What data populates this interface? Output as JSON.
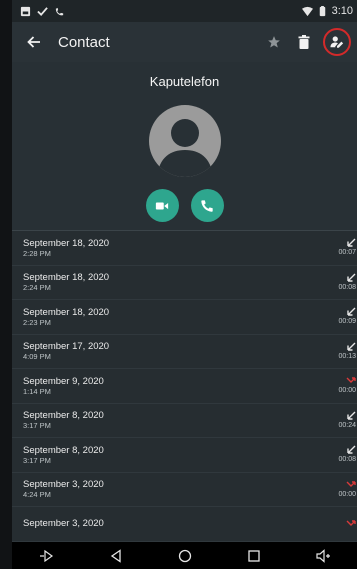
{
  "status_bar": {
    "time": "3:10"
  },
  "app_bar": {
    "title": "Contact"
  },
  "contact": {
    "name": "Kaputelefon"
  },
  "colors": {
    "accent": "#2ea68e",
    "missed": "#d83a3a",
    "highlight_ring": "#d32a2a"
  },
  "history": [
    {
      "date": "September 18, 2020",
      "time": "2:28 PM",
      "duration": "00:07",
      "type": "incoming"
    },
    {
      "date": "September 18, 2020",
      "time": "2:24 PM",
      "duration": "00:08",
      "type": "incoming"
    },
    {
      "date": "September 18, 2020",
      "time": "2:23 PM",
      "duration": "00:09",
      "type": "incoming"
    },
    {
      "date": "September 17, 2020",
      "time": "4:09 PM",
      "duration": "00:13",
      "type": "incoming"
    },
    {
      "date": "September 9, 2020",
      "time": "1:14 PM",
      "duration": "00:00",
      "type": "missed"
    },
    {
      "date": "September 8, 2020",
      "time": "3:17 PM",
      "duration": "00:24",
      "type": "incoming"
    },
    {
      "date": "September 8, 2020",
      "time": "3:17 PM",
      "duration": "00:08",
      "type": "incoming"
    },
    {
      "date": "September 3, 2020",
      "time": "4:24 PM",
      "duration": "00:00",
      "type": "missed"
    },
    {
      "date": "September 3, 2020",
      "time": "",
      "duration": "",
      "type": "missed"
    }
  ],
  "icons": {
    "back": "arrow-back-icon",
    "favorite": "star-icon",
    "delete": "trash-icon",
    "edit": "edit-contact-icon",
    "video": "video-call-icon",
    "call": "phone-icon"
  }
}
